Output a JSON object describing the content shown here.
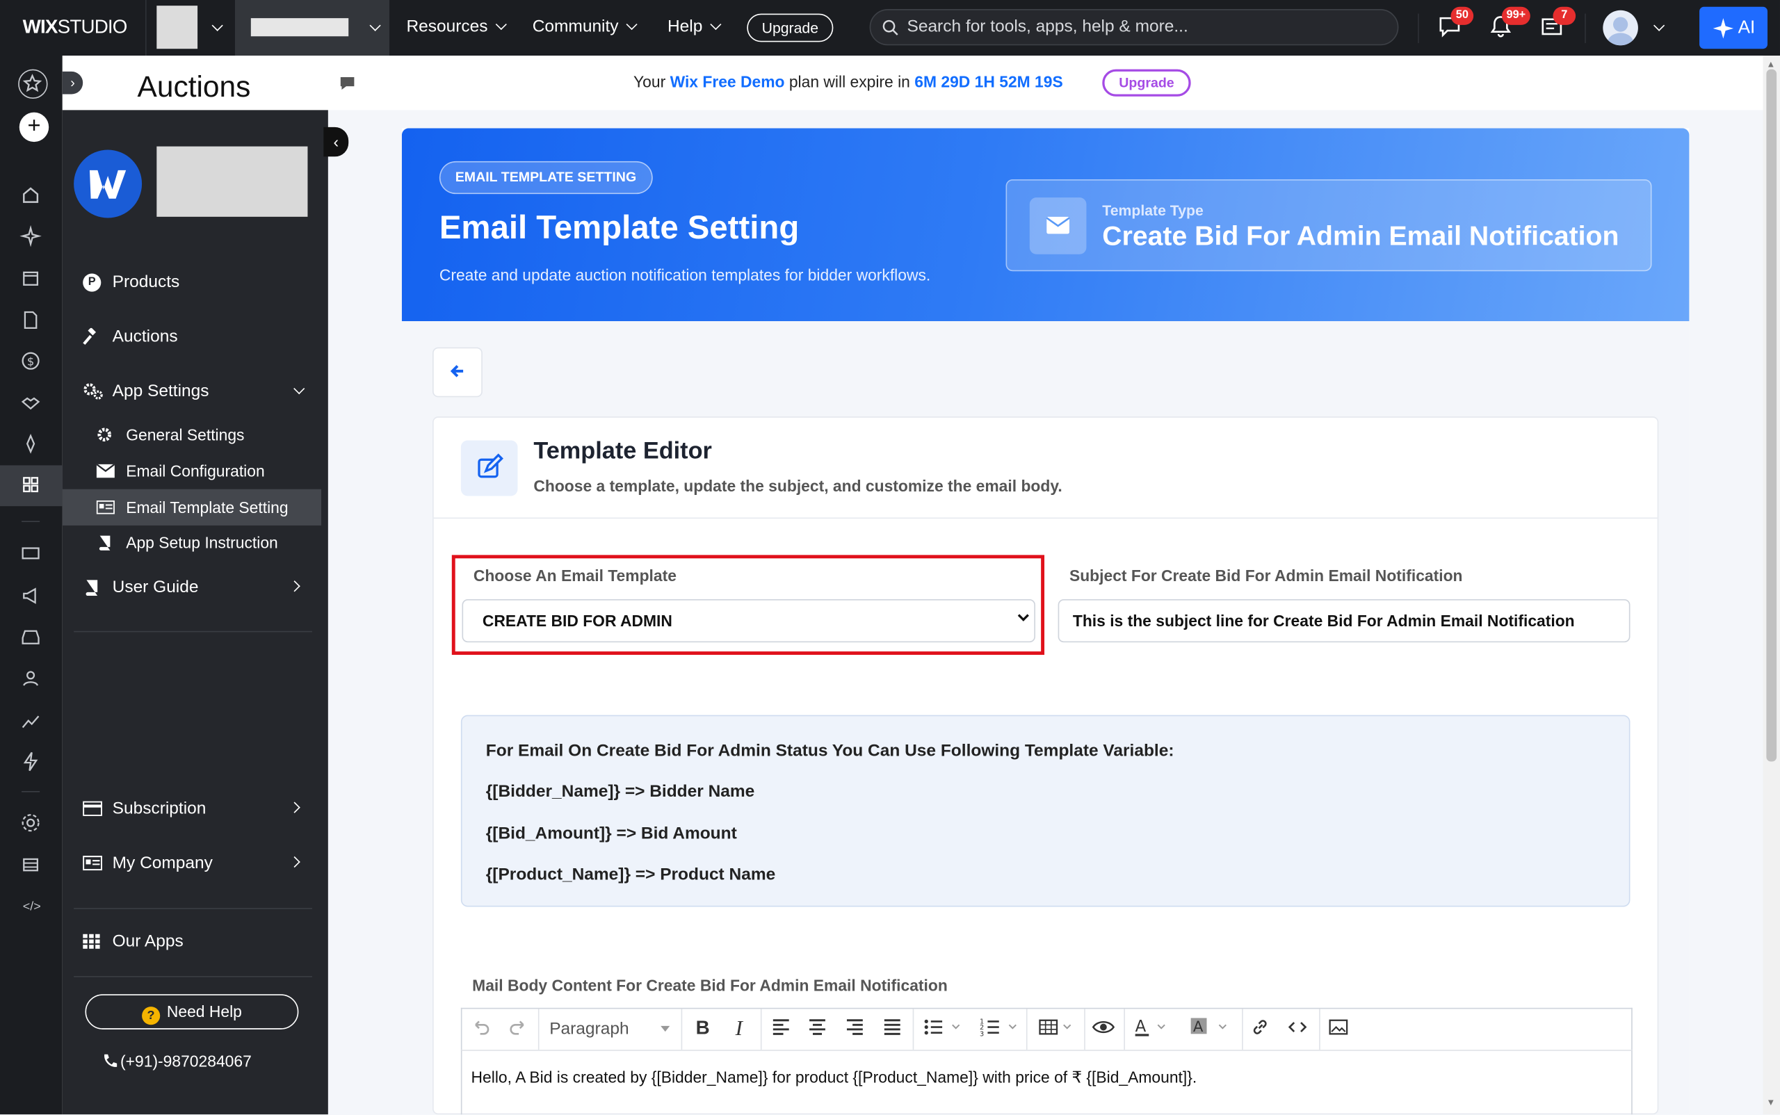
{
  "topbar": {
    "brand_wix": "WIX",
    "brand_studio": "STUDIO",
    "menu": [
      "Resources",
      "Community",
      "Help"
    ],
    "upgrade_label": "Upgrade",
    "search_placeholder": "Search for tools, apps, help & more...",
    "badges": {
      "messages": "50",
      "notifications": "99+",
      "tasks": "7"
    },
    "ai_label": "AI"
  },
  "header": {
    "title": "Auctions",
    "expiry_prefix": "Your",
    "plan_name": "Wix Free Demo",
    "expiry_mid": "plan will expire in",
    "countdown": [
      "6M",
      "29D",
      "1H",
      "52M",
      "19S"
    ],
    "upgrade_label": "Upgrade"
  },
  "sidebar": {
    "items": [
      {
        "label": "Products",
        "icon": "products-icon"
      },
      {
        "label": "Auctions",
        "icon": "gavel-icon"
      },
      {
        "label": "App Settings",
        "icon": "gears-icon"
      }
    ],
    "sub_items": [
      {
        "label": "General Settings",
        "icon": "gear-icon"
      },
      {
        "label": "Email Configuration",
        "icon": "envelope-icon"
      },
      {
        "label": "Email Template Setting",
        "icon": "id-card-icon",
        "active": true
      },
      {
        "label": "App Setup Instruction",
        "icon": "book-icon"
      }
    ],
    "user_guide": "User Guide",
    "subscription": "Subscription",
    "my_company": "My Company",
    "our_apps": "Our Apps",
    "need_help": "Need Help",
    "phone": "(+91)-9870284067"
  },
  "hero": {
    "tag": "EMAIL TEMPLATE SETTING",
    "title": "Email Template Setting",
    "subtitle": "Create and update auction notification templates for bidder workflows.",
    "card_label": "Template Type",
    "card_value": "Create Bid For Admin Email Notification"
  },
  "editor": {
    "title": "Template Editor",
    "subtitle": "Choose a template, update the subject, and customize the email body.",
    "choose_label": "Choose An Email Template",
    "choose_value": "CREATE BID FOR ADMIN",
    "subject_label": "Subject For Create Bid For Admin Email Notification",
    "subject_value": "This is the subject line for Create Bid For Admin Email Notification",
    "vars_heading": "For Email On Create Bid For Admin Status You Can Use Following Template Variable:",
    "vars": [
      "{[Bidder_Name]}  => Bidder Name",
      "{[Bid_Amount]}  => Bid Amount",
      "{[Product_Name]}  => Product Name"
    ],
    "body_label": "Mail Body Content For Create Bid For Admin Email Notification",
    "format_select": "Paragraph",
    "body_text": "Hello, A Bid is created by {[Bidder_Name]} for product {[Product_Name]} with price of ₹ {[Bid_Amount]}."
  },
  "colors": {
    "accent": "#1462f0",
    "highlight": "#e0111b",
    "upgrade": "#a54be5"
  }
}
